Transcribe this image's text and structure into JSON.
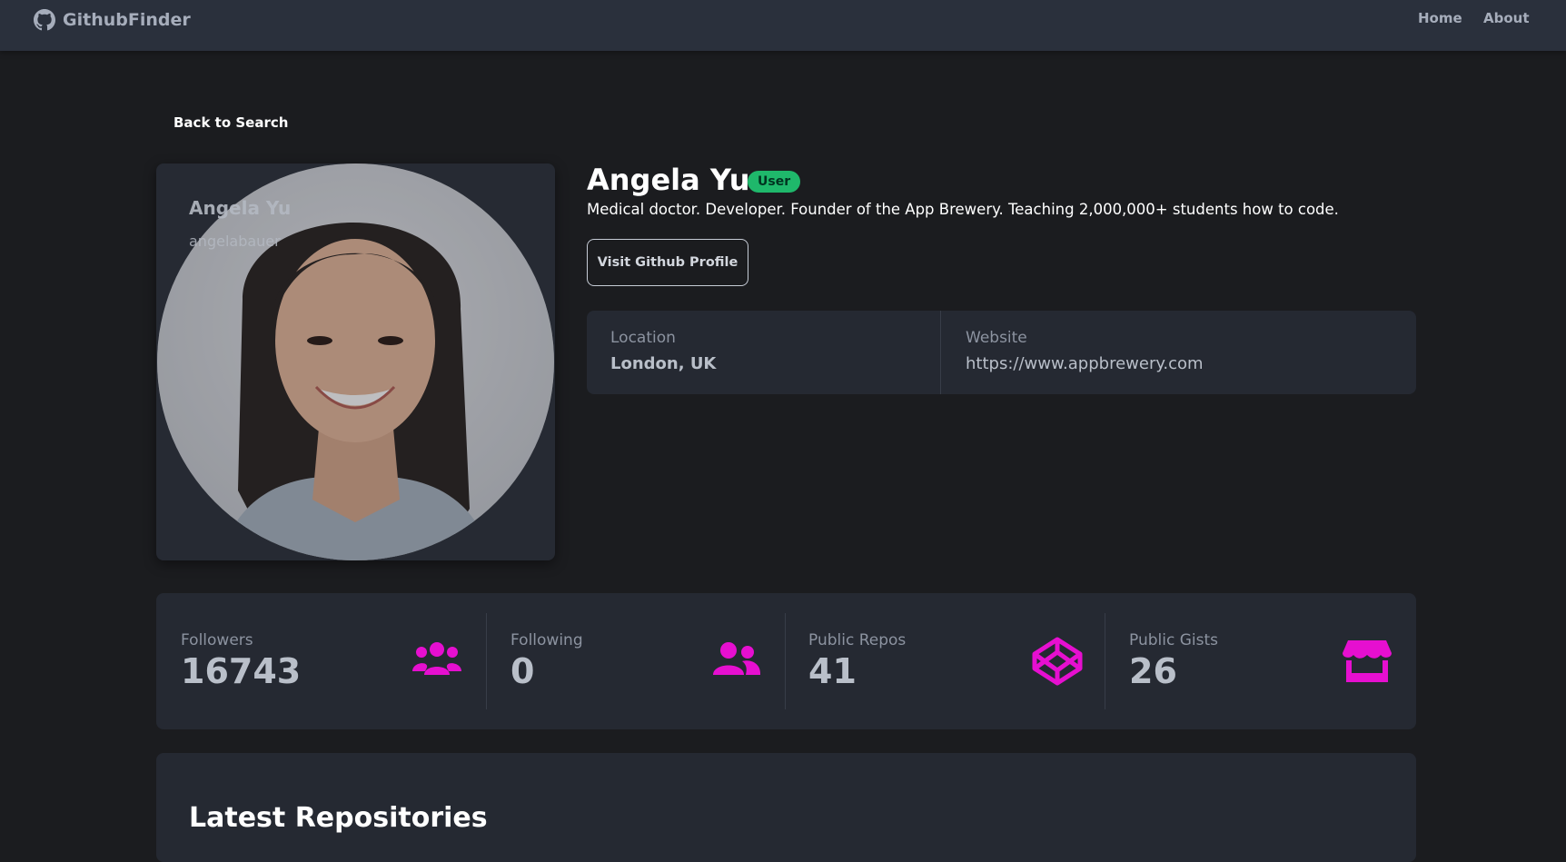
{
  "nav": {
    "brand": "GithubFinder",
    "home": "Home",
    "about": "About"
  },
  "back_link": "Back to Search",
  "avatar_card": {
    "name": "Angela Yu",
    "login": "angelabauer"
  },
  "profile": {
    "name": "Angela Yu",
    "badge": "User",
    "bio": "Medical doctor. Developer. Founder of the App Brewery. Teaching 2,000,000+ students how to code.",
    "visit_button": "Visit Github Profile"
  },
  "info": {
    "location_label": "Location",
    "location_value": "London, UK",
    "website_label": "Website",
    "website_value": "https://www.appbrewery.com"
  },
  "stats": {
    "followers_label": "Followers",
    "followers_value": "16743",
    "following_label": "Following",
    "following_value": "0",
    "repos_label": "Public Repos",
    "repos_value": "41",
    "gists_label": "Public Gists",
    "gists_value": "26"
  },
  "repos": {
    "title": "Latest Repositories"
  },
  "icons": {
    "brand": "github-icon",
    "followers": "users-icon",
    "following": "user-friends-icon",
    "repos": "codepen-icon",
    "gists": "store-icon"
  },
  "colors": {
    "accent_icon": "#e60fd0",
    "badge": "#1fb86b"
  }
}
